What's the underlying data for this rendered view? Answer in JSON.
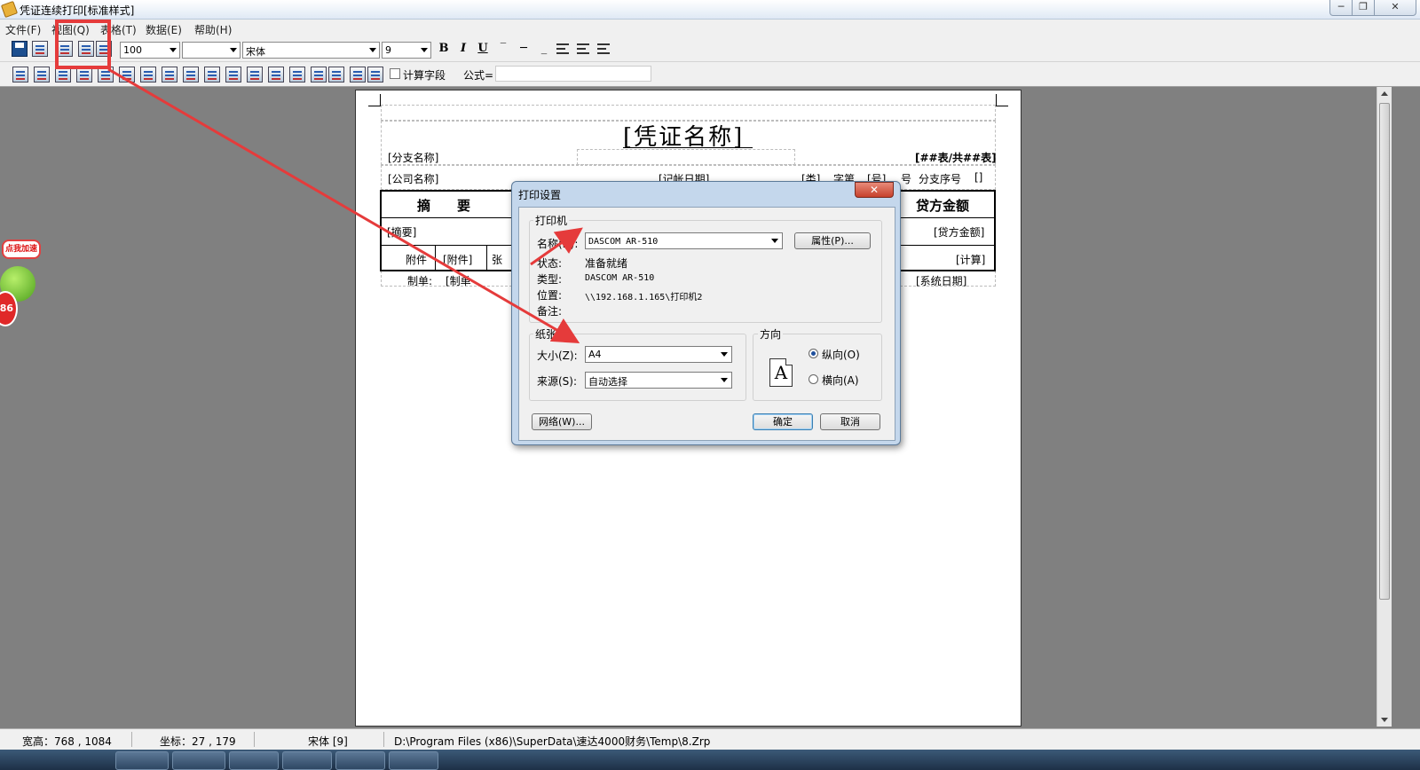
{
  "window": {
    "title": "凭证连续打印[标准样式]",
    "controls": {
      "minimize": "─",
      "maximize": "❐",
      "close": "✕"
    }
  },
  "menu": {
    "items": [
      "文件(F)",
      "视图(Q)",
      "表格(T)",
      "数据(E)",
      "帮助(H)"
    ]
  },
  "toolbar": {
    "zoom_value": "100",
    "style_value": "",
    "font_name": "宋体",
    "font_size": "9",
    "bold": "B",
    "italic": "I",
    "underline": "U",
    "calc_field_label": "计算字段",
    "formula_label": "公式=",
    "formula_value": ""
  },
  "form": {
    "title": "[凭证名称]",
    "branch_name": "[分支名称]",
    "table_count": "[##表/共##表]",
    "company_name": "[公司名称]",
    "record_date": "[记帐日期]",
    "category": "[类]",
    "word": "字第",
    "number": "[号]",
    "number_suffix": "号",
    "branch_seq": "分支序号",
    "branch_seq_val": "[]",
    "col_summary": "摘　　要",
    "col_credit": "贷方金额",
    "summary_field": "[摘要]",
    "credit_field": "[贷方金额]",
    "attach_label": "附件",
    "attach_field": "[附件]",
    "attach_unit": "张",
    "calc_field": "[计算]",
    "maker_label": "制单:",
    "maker_field": "[制单",
    "system_date": "[系统日期]"
  },
  "dialog": {
    "title": "打印设置",
    "close": "✕",
    "printer_group": "打印机",
    "name_label": "名称(N):",
    "printer_name": "DASCOM AR-510",
    "properties_button": "属性(P)...",
    "status_label": "状态:",
    "status_value": "准备就绪",
    "type_label": "类型:",
    "type_value": "DASCOM AR-510",
    "location_label": "位置:",
    "location_value": "\\\\192.168.1.165\\打印机2",
    "comment_label": "备注:",
    "comment_value": "",
    "paper_group": "纸张",
    "size_label": "大小(Z):",
    "size_value": "A4",
    "source_label": "来源(S):",
    "source_value": "自动选择",
    "orientation_group": "方向",
    "orient_icon_letter": "A",
    "portrait_label": "纵向(O)",
    "landscape_label": "横向(A)",
    "orientation_selected": "portrait",
    "network_button": "网络(W)...",
    "ok_button": "确定",
    "cancel_button": "取消"
  },
  "widget": {
    "bubble_text": "点我加速",
    "badge_value": "86"
  },
  "statusbar": {
    "size": "宽高：768 , 1084",
    "coords": "坐标：27 , 179",
    "font": "宋体 [9]",
    "path": "D:\\Program Files (x86)\\SuperData\\速达4000财务\\Temp\\8.Zrp"
  },
  "colors": {
    "annotation_red": "#e53b3b",
    "workspace_gray": "#808080",
    "dialog_frame": "#c4d7ec"
  }
}
